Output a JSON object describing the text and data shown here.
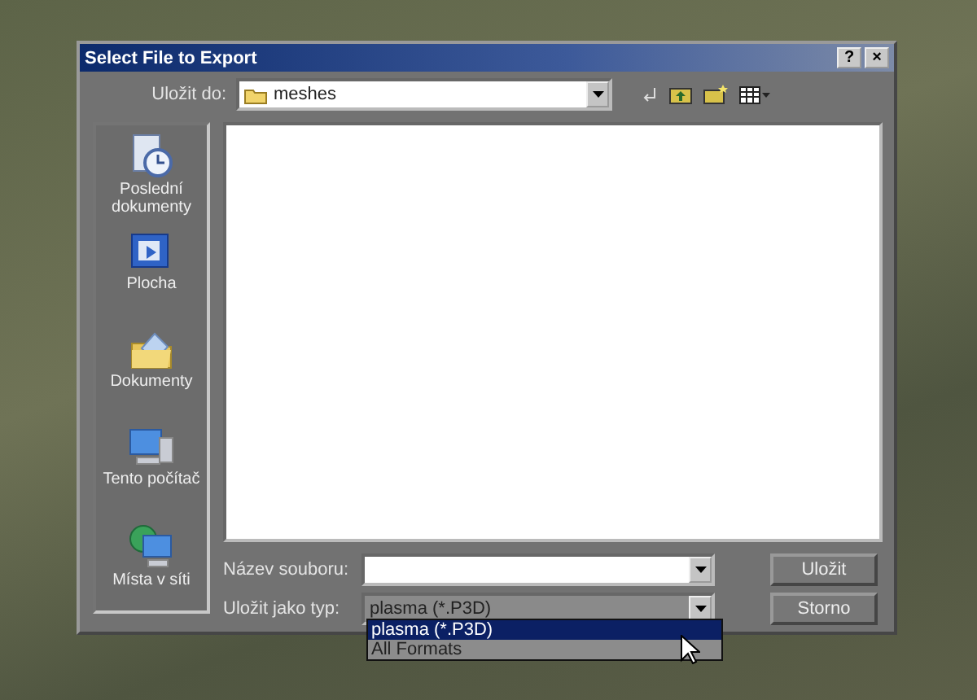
{
  "window": {
    "title": "Select File to Export",
    "help_button": "?",
    "close_button": "×"
  },
  "save_in": {
    "label": "Uložit do:",
    "value": "meshes"
  },
  "places": [
    {
      "label": "Poslední dokumenty",
      "kind": "recent"
    },
    {
      "label": "Plocha",
      "kind": "desktop"
    },
    {
      "label": "Dokumenty",
      "kind": "documents"
    },
    {
      "label": "Tento počítač",
      "kind": "computer"
    },
    {
      "label": "Místa v síti",
      "kind": "network"
    }
  ],
  "file_name": {
    "label": "Název souboru:"
  },
  "file_type": {
    "label": "Uložit jako typ:",
    "value": "plasma (*.P3D)",
    "expanded": true,
    "options": [
      {
        "label": "plasma (*.P3D)",
        "selected": true
      },
      {
        "label": "All Formats",
        "selected": false
      }
    ]
  },
  "buttons": [
    {
      "label": "Uložit"
    },
    {
      "label": "Storno"
    }
  ]
}
